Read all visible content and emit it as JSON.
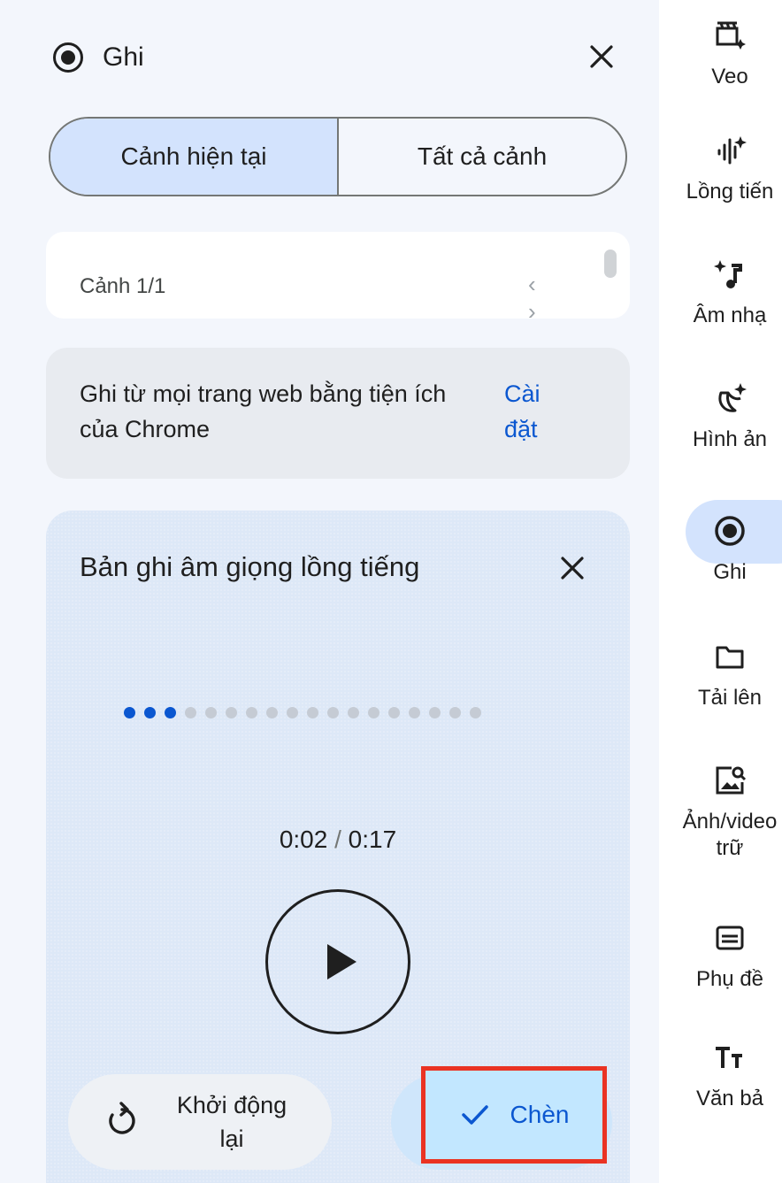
{
  "panel": {
    "title": "Ghi",
    "segments": [
      "Cảnh hiện tại",
      "Tất cả cảnh"
    ],
    "active_segment": 0,
    "scene_label": "Cảnh 1/1",
    "extension_text": "Ghi từ mọi trang web bằng tiện ích của Chrome",
    "extension_link": "Cài đặt"
  },
  "recording_card": {
    "title": "Bản ghi âm giọng lồng tiếng",
    "progress_dots_total": 18,
    "progress_dots_filled": 3,
    "time_current": "0:02",
    "time_separator": "/",
    "time_total": "0:17",
    "restart_label": "Khởi động lại",
    "insert_label": "Chèn"
  },
  "rail": {
    "items": [
      {
        "label": "Veo",
        "icon": "clapperboard-sparkle-icon"
      },
      {
        "label": "Lồng tiến",
        "icon": "audio-wave-sparkle-icon"
      },
      {
        "label": "Âm nhạ",
        "icon": "music-note-sparkle-icon"
      },
      {
        "label": "Hình ản",
        "icon": "banana-sparkle-icon"
      },
      {
        "label": "Ghi",
        "icon": "record-icon",
        "active": true
      },
      {
        "label": "Tải lên",
        "icon": "folder-icon"
      },
      {
        "label": "Ảnh/video",
        "label2": "trữ",
        "icon": "image-search-icon"
      },
      {
        "label": "Phụ đề",
        "icon": "subtitles-icon"
      },
      {
        "label": "Văn bả",
        "icon": "text-format-icon"
      }
    ]
  },
  "colors": {
    "accent": "#0b57d0",
    "selected_bg": "#d3e3fd",
    "highlight_border": "#ea3323"
  }
}
